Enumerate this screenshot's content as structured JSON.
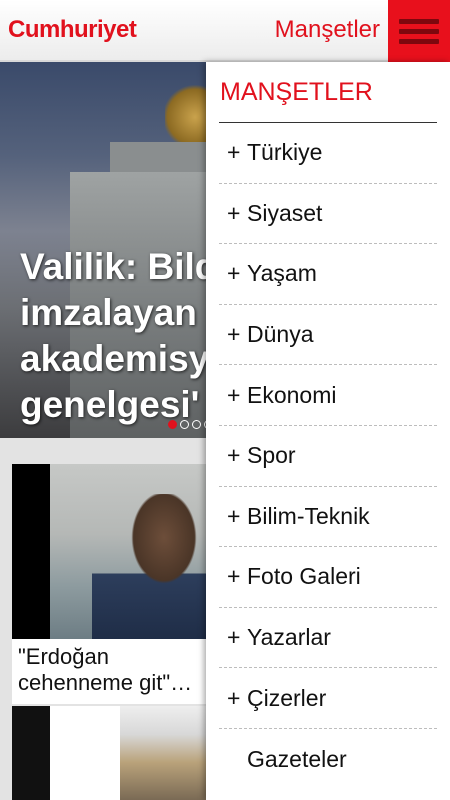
{
  "header": {
    "logo": "Cumhuriyet",
    "section_title": "Manşetler",
    "menu_icon": "hamburger-menu-icon"
  },
  "hero": {
    "headline": "Valilik: Bild\nimzalayan\nakademisyen\ngenelgesi' u",
    "slide_count": 5,
    "active_slide": 0
  },
  "cards": [
    {
      "caption": "\"Erdoğan\ncehenneme git\"…"
    }
  ],
  "dropdown": {
    "title": "MANŞETLER",
    "items": [
      {
        "prefix": "+",
        "label": "Türkiye"
      },
      {
        "prefix": "+",
        "label": "Siyaset"
      },
      {
        "prefix": "+",
        "label": "Yaşam"
      },
      {
        "prefix": "+",
        "label": "Dünya"
      },
      {
        "prefix": "+",
        "label": "Ekonomi"
      },
      {
        "prefix": "+",
        "label": "Spor"
      },
      {
        "prefix": "+",
        "label": "Bilim-Teknik"
      },
      {
        "prefix": "+",
        "label": "Foto Galeri"
      },
      {
        "prefix": "+",
        "label": "Yazarlar"
      },
      {
        "prefix": "+",
        "label": "Çizerler"
      },
      {
        "prefix": "",
        "label": "Gazeteler"
      }
    ]
  },
  "colors": {
    "brand_red": "#e1111d",
    "menu_button": "#e8101c"
  }
}
